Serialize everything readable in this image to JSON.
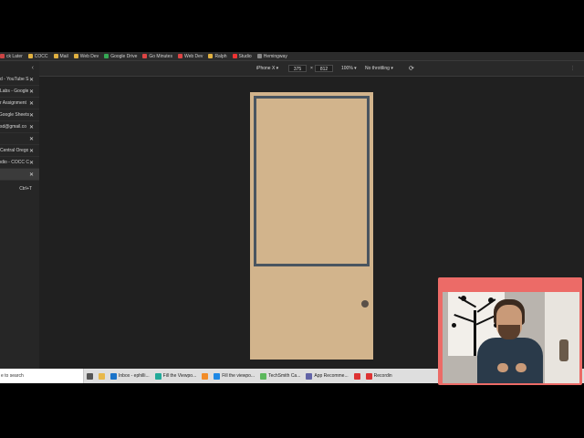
{
  "bookmarks": [
    {
      "label": "ck Later",
      "color": "#cc4444"
    },
    {
      "label": "COCC",
      "color": "#e0b040"
    },
    {
      "label": "Mail",
      "color": "#e0b040"
    },
    {
      "label": "Web Dev",
      "color": "#e0b040"
    },
    {
      "label": "Google Drive",
      "color": "#34a853"
    },
    {
      "label": "Go Minutes",
      "color": "#d44"
    },
    {
      "label": "Web Dev",
      "color": "#d44"
    },
    {
      "label": "Ralph",
      "color": "#e0b040"
    },
    {
      "label": "Studio",
      "color": "#e33"
    },
    {
      "label": "Hemingway",
      "color": "#888"
    }
  ],
  "sidebar": {
    "tabs": [
      {
        "label": "d - YouTube S",
        "active": false
      },
      {
        "label": "Labs - Google",
        "active": false
      },
      {
        "label": "r Assignment",
        "active": false
      },
      {
        "label": "Google Sheets",
        "active": false
      },
      {
        "label": "sd@gmail.co",
        "active": false
      },
      {
        "label": "",
        "active": false
      },
      {
        "label": "Central Orego",
        "active": false
      },
      {
        "label": "odio - COCC C",
        "active": false
      },
      {
        "label": "",
        "active": true
      }
    ],
    "new_tab_shortcut": "Ctrl+T"
  },
  "devtools": {
    "device": "iPhone X ▾",
    "width": "375",
    "times": "×",
    "height": "812",
    "zoom": "100% ▾",
    "throttling": "No throttling ▾",
    "rotate_icon": "rotate-icon",
    "more_icon": "more-icon"
  },
  "taskbar": {
    "search_placeholder": "e to search",
    "items": [
      {
        "label": "",
        "icon": "task-view-icon",
        "color": "#555"
      },
      {
        "label": "",
        "icon": "file-explorer-icon",
        "color": "#e8b84a"
      },
      {
        "label": "Inbox - ephilli...",
        "icon": "outlook-icon",
        "color": "#1a73c9"
      },
      {
        "label": "Fill the Viewpo...",
        "icon": "chrome-icon",
        "color": "#2a9"
      },
      {
        "label": "",
        "icon": "sublime-icon",
        "color": "#f28c28"
      },
      {
        "label": "Fill the viewpo...",
        "icon": "vscode-icon",
        "color": "#1e88e5"
      },
      {
        "label": "TechSmith Ca...",
        "icon": "camtasia-icon",
        "color": "#5cb85c"
      },
      {
        "label": "App Recomme...",
        "icon": "teams-icon",
        "color": "#6264a7"
      },
      {
        "label": "",
        "icon": "app-icon",
        "color": "#d33"
      },
      {
        "label": "Recordin",
        "icon": "record-icon",
        "color": "#d33"
      }
    ]
  },
  "colors": {
    "door": "#d2b48c",
    "door_panel_border": "#4a5560",
    "knob": "#5a5048",
    "webcam_frame": "#ec6b67"
  }
}
